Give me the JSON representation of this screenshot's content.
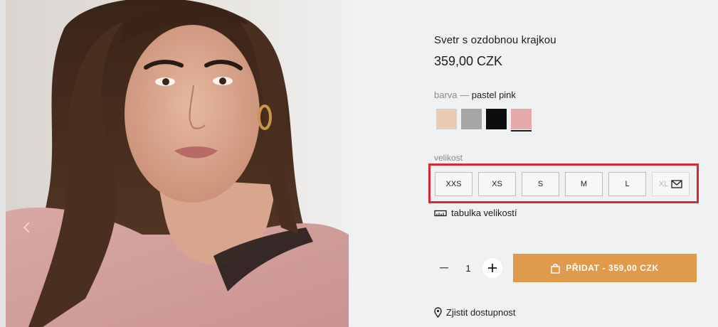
{
  "product": {
    "title": "Svetr s ozdobnou krajkou",
    "price": "359,00 CZK"
  },
  "color": {
    "label": "barva —",
    "selected_name": "pastel pink",
    "swatches": [
      {
        "name": "beige",
        "hex": "#e8cbb2"
      },
      {
        "name": "grey",
        "hex": "#a6a6a6"
      },
      {
        "name": "black",
        "hex": "#0d0d0d"
      },
      {
        "name": "pastel pink",
        "hex": "#e5aaaa",
        "selected": true
      }
    ]
  },
  "size": {
    "label": "velikost",
    "options": [
      {
        "label": "XXS",
        "available": true
      },
      {
        "label": "XS",
        "available": true
      },
      {
        "label": "S",
        "available": true
      },
      {
        "label": "M",
        "available": true
      },
      {
        "label": "L",
        "available": true
      },
      {
        "label": "XL",
        "available": false
      }
    ],
    "chart_link": "tabulka velikostí"
  },
  "cart": {
    "quantity": "1",
    "add_button_label": "PŘIDAT - 359,00 CZK"
  },
  "availability_link": "Zjistit dostupnost",
  "icons": {
    "ruler": "ruler-icon",
    "mail": "mail-icon",
    "bag": "shopping-bag-icon",
    "pin": "location-pin-icon",
    "minus": "minus-icon",
    "plus": "plus-icon"
  },
  "colors": {
    "background": "#f0f1f3",
    "accent": "#e09a4c",
    "highlight": "#d42a32",
    "text": "#1c1c1c"
  }
}
